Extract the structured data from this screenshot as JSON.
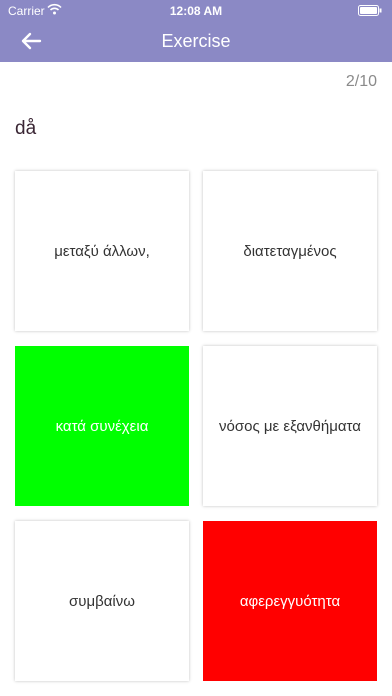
{
  "status_bar": {
    "carrier": "Carrier",
    "time": "12:08 AM"
  },
  "nav": {
    "title": "Exercise",
    "back_icon": "arrow-left-icon"
  },
  "progress": "2/10",
  "prompt": "då",
  "colors": {
    "header": "#8b89c5",
    "correct": "#00ff00",
    "wrong": "#ff0000",
    "card": "#ffffff"
  },
  "options": [
    {
      "text": "μεταξύ άλλων,",
      "state": "normal"
    },
    {
      "text": "διατεταγμένος",
      "state": "normal"
    },
    {
      "text": "κατά συνέχεια",
      "state": "correct"
    },
    {
      "text": "νόσος με εξανθήματα",
      "state": "normal"
    },
    {
      "text": "συμβαίνω",
      "state": "normal"
    },
    {
      "text": "αφερεγγυότητα",
      "state": "wrong"
    }
  ]
}
